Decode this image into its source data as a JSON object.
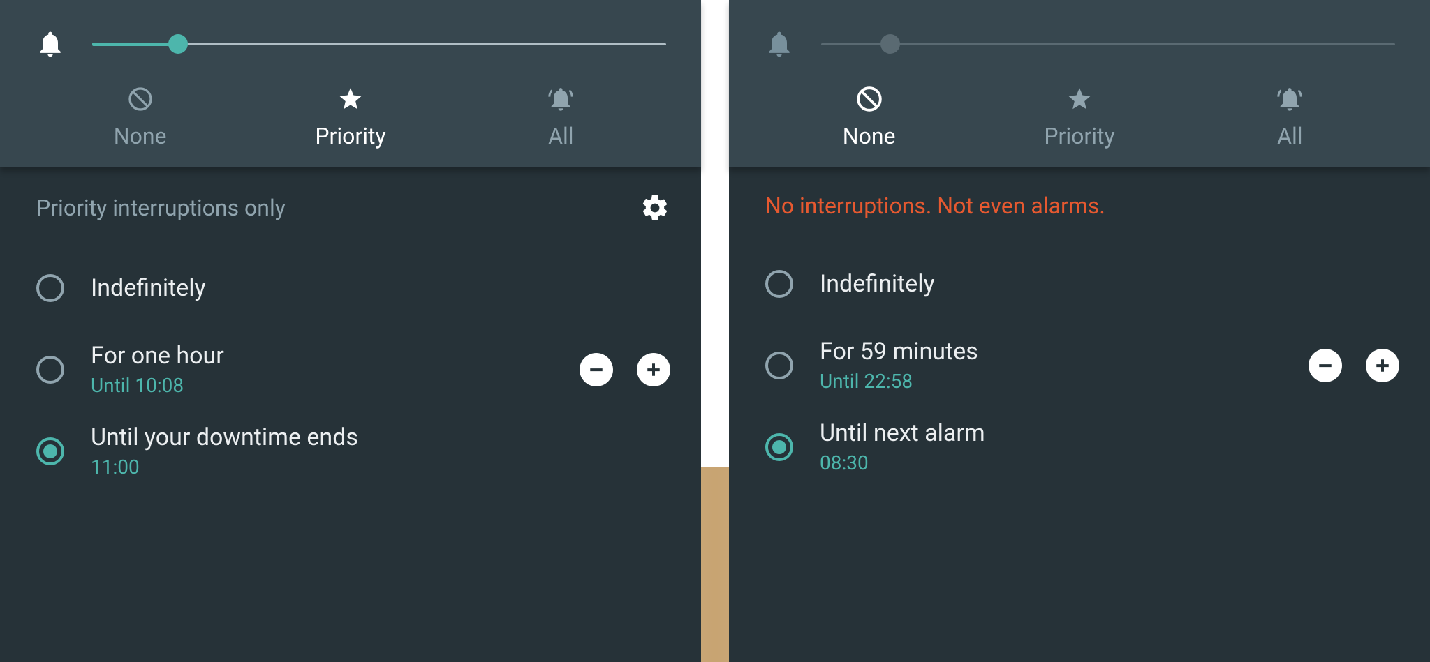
{
  "panels": [
    {
      "slider": {
        "percent": 15,
        "active_color": "#4DB6AC",
        "track_color": "#B0BEC5",
        "thumb_color": "#4DB6AC",
        "bell_color": "#FFFFFF"
      },
      "tabs": {
        "none": "None",
        "priority": "Priority",
        "all": "All",
        "selected": "priority"
      },
      "header": {
        "text": "Priority interruptions only",
        "warn": false,
        "show_gear": true
      },
      "options": [
        {
          "id": "indefinitely",
          "label": "Indefinitely",
          "sub": "",
          "selected": false,
          "stepper": false
        },
        {
          "id": "for-duration",
          "label": "For one hour",
          "sub": "Until 10:08",
          "selected": false,
          "stepper": true
        },
        {
          "id": "until-downtime",
          "label": "Until your downtime ends",
          "sub": "11:00",
          "selected": true,
          "stepper": false
        }
      ]
    },
    {
      "slider": {
        "percent": 12,
        "active_color": "rgba(144,164,174,0)",
        "track_color": "#5a6a72",
        "thumb_color": "#5a6a72",
        "bell_color": "#78909C"
      },
      "tabs": {
        "none": "None",
        "priority": "Priority",
        "all": "All",
        "selected": "none"
      },
      "header": {
        "text": "No interruptions. Not even alarms.",
        "warn": true,
        "show_gear": false
      },
      "options": [
        {
          "id": "indefinitely",
          "label": "Indefinitely",
          "sub": "",
          "selected": false,
          "stepper": false
        },
        {
          "id": "for-duration",
          "label": "For 59 minutes",
          "sub": "Until 22:58",
          "selected": false,
          "stepper": true
        },
        {
          "id": "until-next-alarm",
          "label": "Until next alarm",
          "sub": "08:30",
          "selected": true,
          "stepper": false
        }
      ]
    }
  ],
  "colors": {
    "accent": "#4DB6AC",
    "panel_bg": "#263238",
    "topbar_bg": "#37474F",
    "warn": "#E65930"
  }
}
